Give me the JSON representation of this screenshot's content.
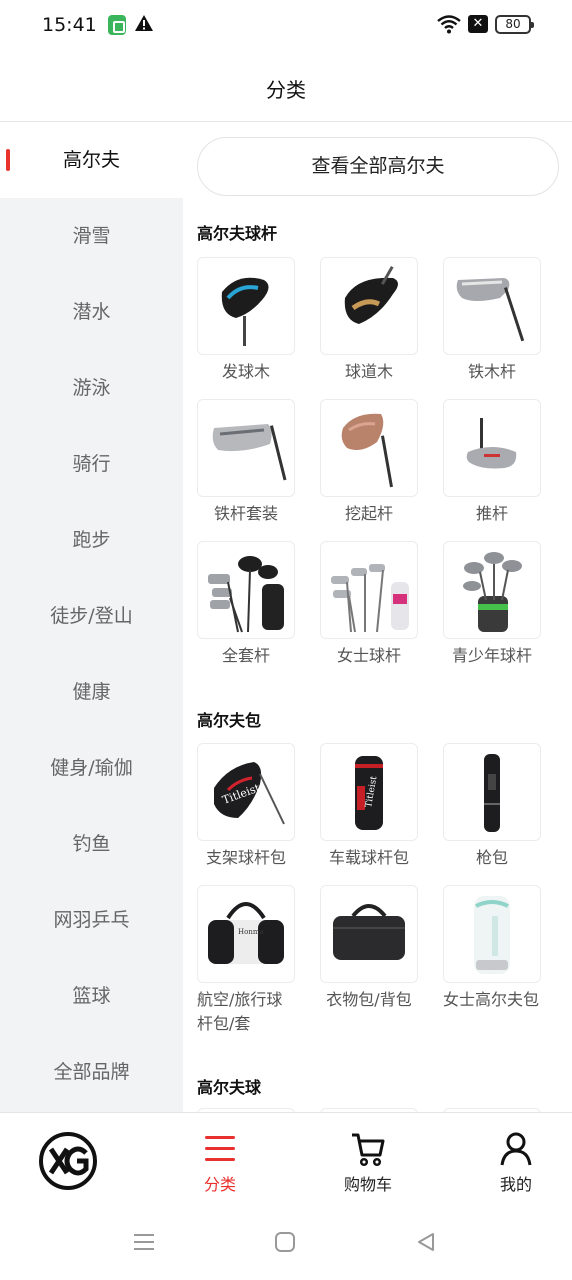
{
  "status_bar": {
    "time": "15:41",
    "battery": "80"
  },
  "header": {
    "title": "分类"
  },
  "sidebar": {
    "items": [
      {
        "label": "高尔夫",
        "active": true
      },
      {
        "label": "滑雪"
      },
      {
        "label": "潜水"
      },
      {
        "label": "游泳"
      },
      {
        "label": "骑行"
      },
      {
        "label": "跑步"
      },
      {
        "label": "徒步/登山"
      },
      {
        "label": "健康"
      },
      {
        "label": "健身/瑜伽"
      },
      {
        "label": "钓鱼"
      },
      {
        "label": "网羽乒乓"
      },
      {
        "label": "篮球"
      },
      {
        "label": "全部品牌"
      }
    ]
  },
  "main": {
    "view_all": "查看全部高尔夫",
    "sections": [
      {
        "title": "高尔夫球杆",
        "items": [
          {
            "label": "发球木",
            "icon": "driver-club-image"
          },
          {
            "label": "球道木",
            "icon": "fairway-wood-image"
          },
          {
            "label": "铁木杆",
            "icon": "hybrid-club-image"
          },
          {
            "label": "铁杆套装",
            "icon": "iron-set-image"
          },
          {
            "label": "挖起杆",
            "icon": "wedge-club-image"
          },
          {
            "label": "推杆",
            "icon": "putter-image"
          },
          {
            "label": "全套杆",
            "icon": "full-set-image"
          },
          {
            "label": "女士球杆",
            "icon": "ladies-clubs-image"
          },
          {
            "label": "青少年球杆",
            "icon": "junior-clubs-image"
          }
        ]
      },
      {
        "title": "高尔夫包",
        "items": [
          {
            "label": "支架球杆包",
            "icon": "stand-bag-image"
          },
          {
            "label": "车载球杆包",
            "icon": "cart-bag-image"
          },
          {
            "label": "枪包",
            "icon": "gun-bag-image"
          },
          {
            "label": "航空/旅行球杆包/套",
            "icon": "travel-bag-image"
          },
          {
            "label": "衣物包/背包",
            "icon": "clothing-bag-image"
          },
          {
            "label": "女士高尔夫包",
            "icon": "ladies-bag-image"
          }
        ]
      },
      {
        "title": "高尔夫球"
      }
    ]
  },
  "bottom_nav": {
    "items": [
      {
        "label": "分类",
        "active": true
      },
      {
        "label": "购物车"
      },
      {
        "label": "我的"
      }
    ]
  },
  "colors": {
    "accent": "#e8312f",
    "sidebar_bg": "#f2f3f5"
  }
}
